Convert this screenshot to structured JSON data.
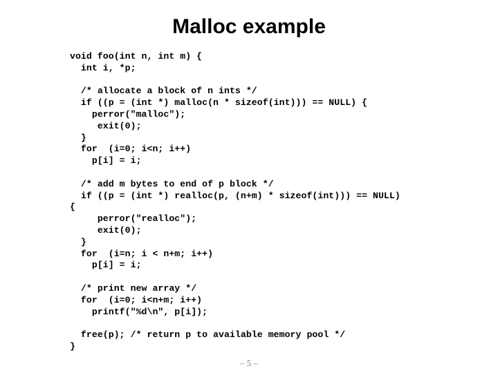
{
  "slide": {
    "title": "Malloc example",
    "background_color": "#ffffff",
    "text_color": "#000000",
    "footer": {
      "page_label": "– 5 –",
      "color": "#808080"
    }
  },
  "code": {
    "language": "C",
    "lines": [
      "void foo(int n, int m) {",
      "  int i, *p;",
      "",
      "  /* allocate a block of n ints */",
      "  if ((p = (int *) malloc(n * sizeof(int))) == NULL) {",
      "    perror(\"malloc\");",
      "     exit(0);",
      "  }",
      "  for  (i=0; i<n; i++)",
      "    p[i] = i;",
      "",
      "  /* add m bytes to end of p block */",
      "  if ((p = (int *) realloc(p, (n+m) * sizeof(int))) == NULL)",
      "{",
      "     perror(\"realloc\");",
      "     exit(0);",
      "  }",
      "  for  (i=n; i < n+m; i++)",
      "    p[i] = i;",
      "",
      "  /* print new array */",
      "  for  (i=0; i<n+m; i++)",
      "    printf(\"%d\\n\", p[i]);",
      "",
      "  free(p); /* return p to available memory pool */",
      "}"
    ]
  }
}
